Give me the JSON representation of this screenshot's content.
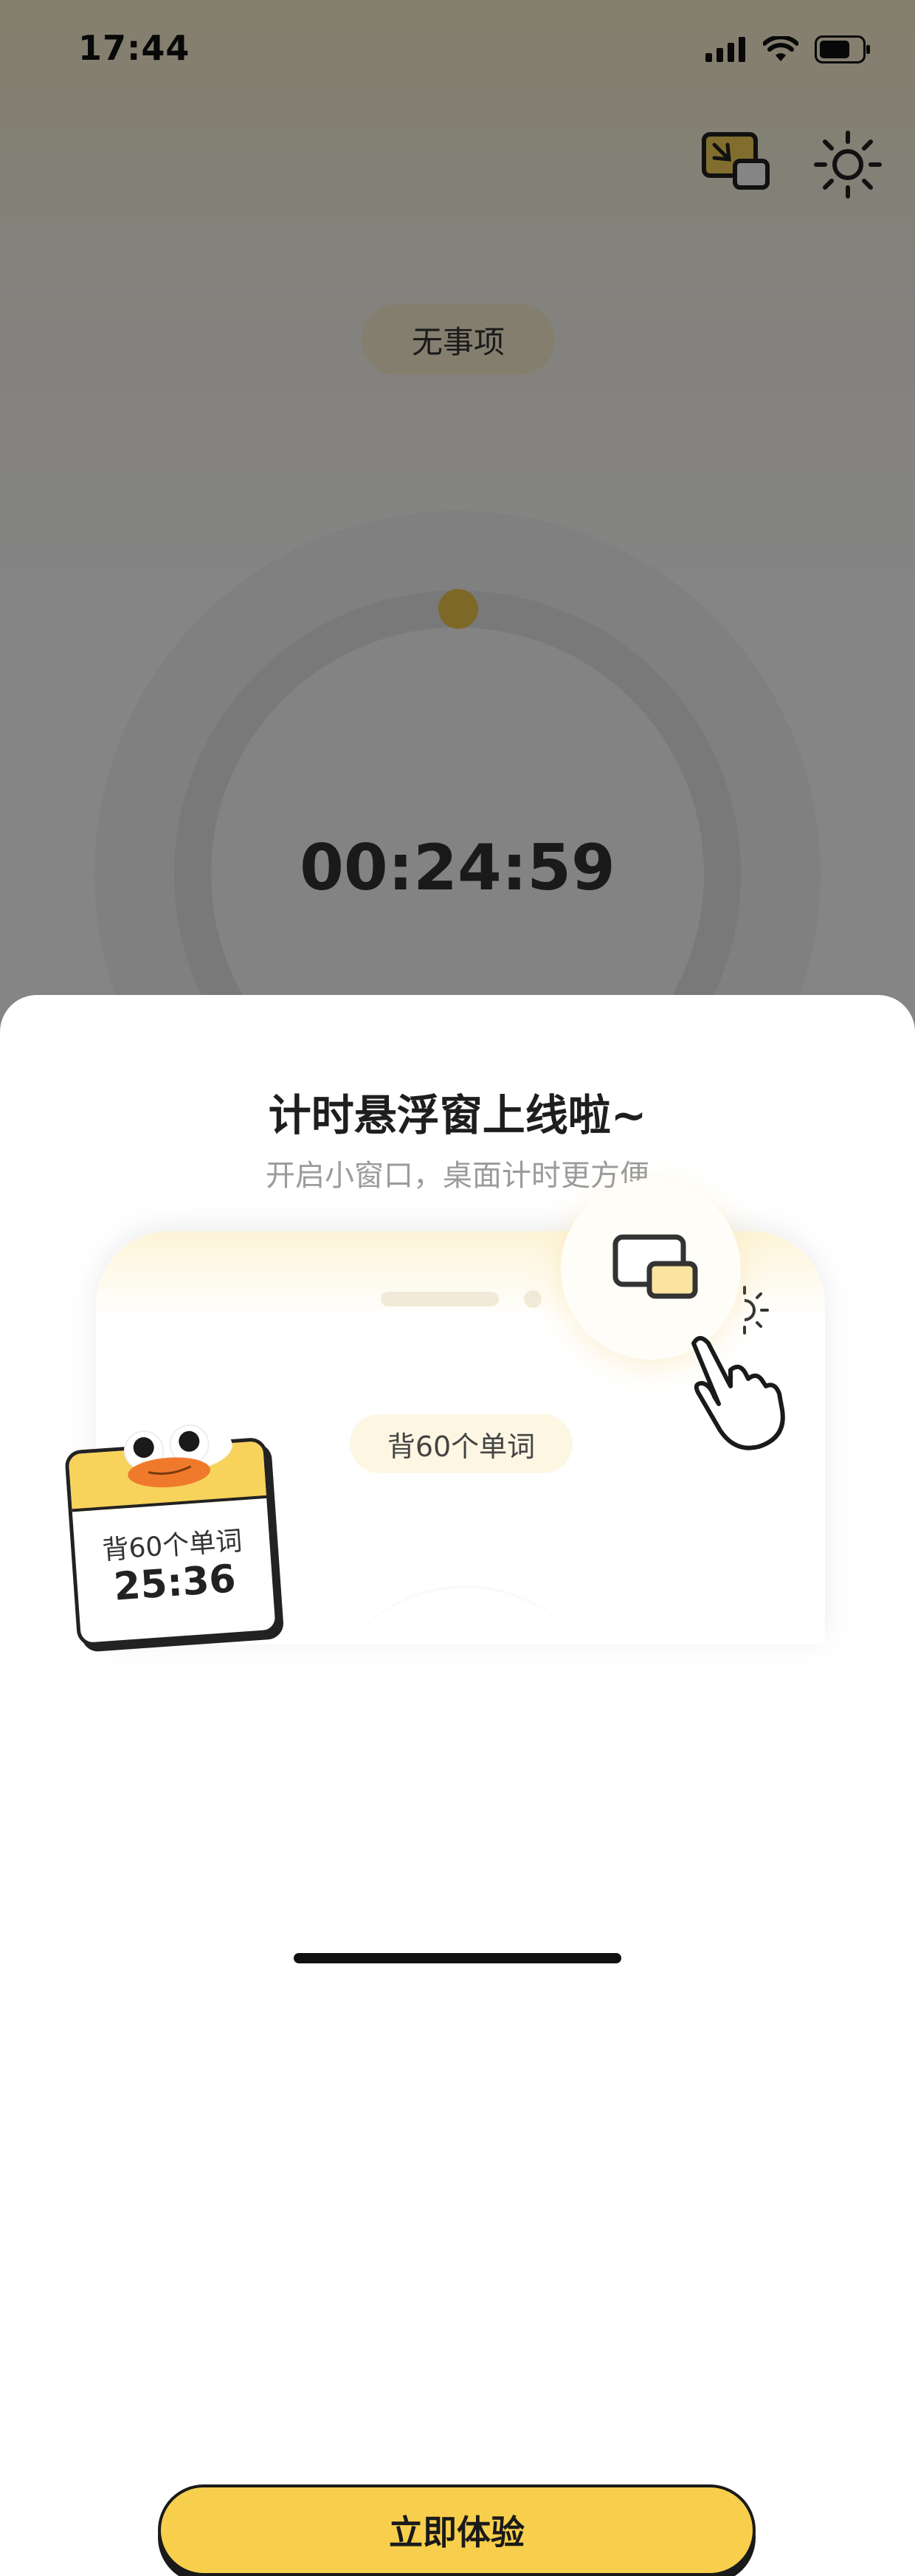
{
  "status_bar": {
    "time": "17:44"
  },
  "main": {
    "task_label": "无事项",
    "timer": "00:24:59"
  },
  "sheet": {
    "title": "计时悬浮窗上线啦~",
    "subtitle": "开启小窗口，桌面计时更方便",
    "illustration": {
      "task_pill": "背60个单词",
      "card_label": "背60个单词",
      "card_time": "25:36"
    },
    "cta_label": "立即体验"
  },
  "colors": {
    "accent": "#f7cf4c",
    "text_dark": "#1e1e1e",
    "text_muted": "#9b9b9b"
  }
}
